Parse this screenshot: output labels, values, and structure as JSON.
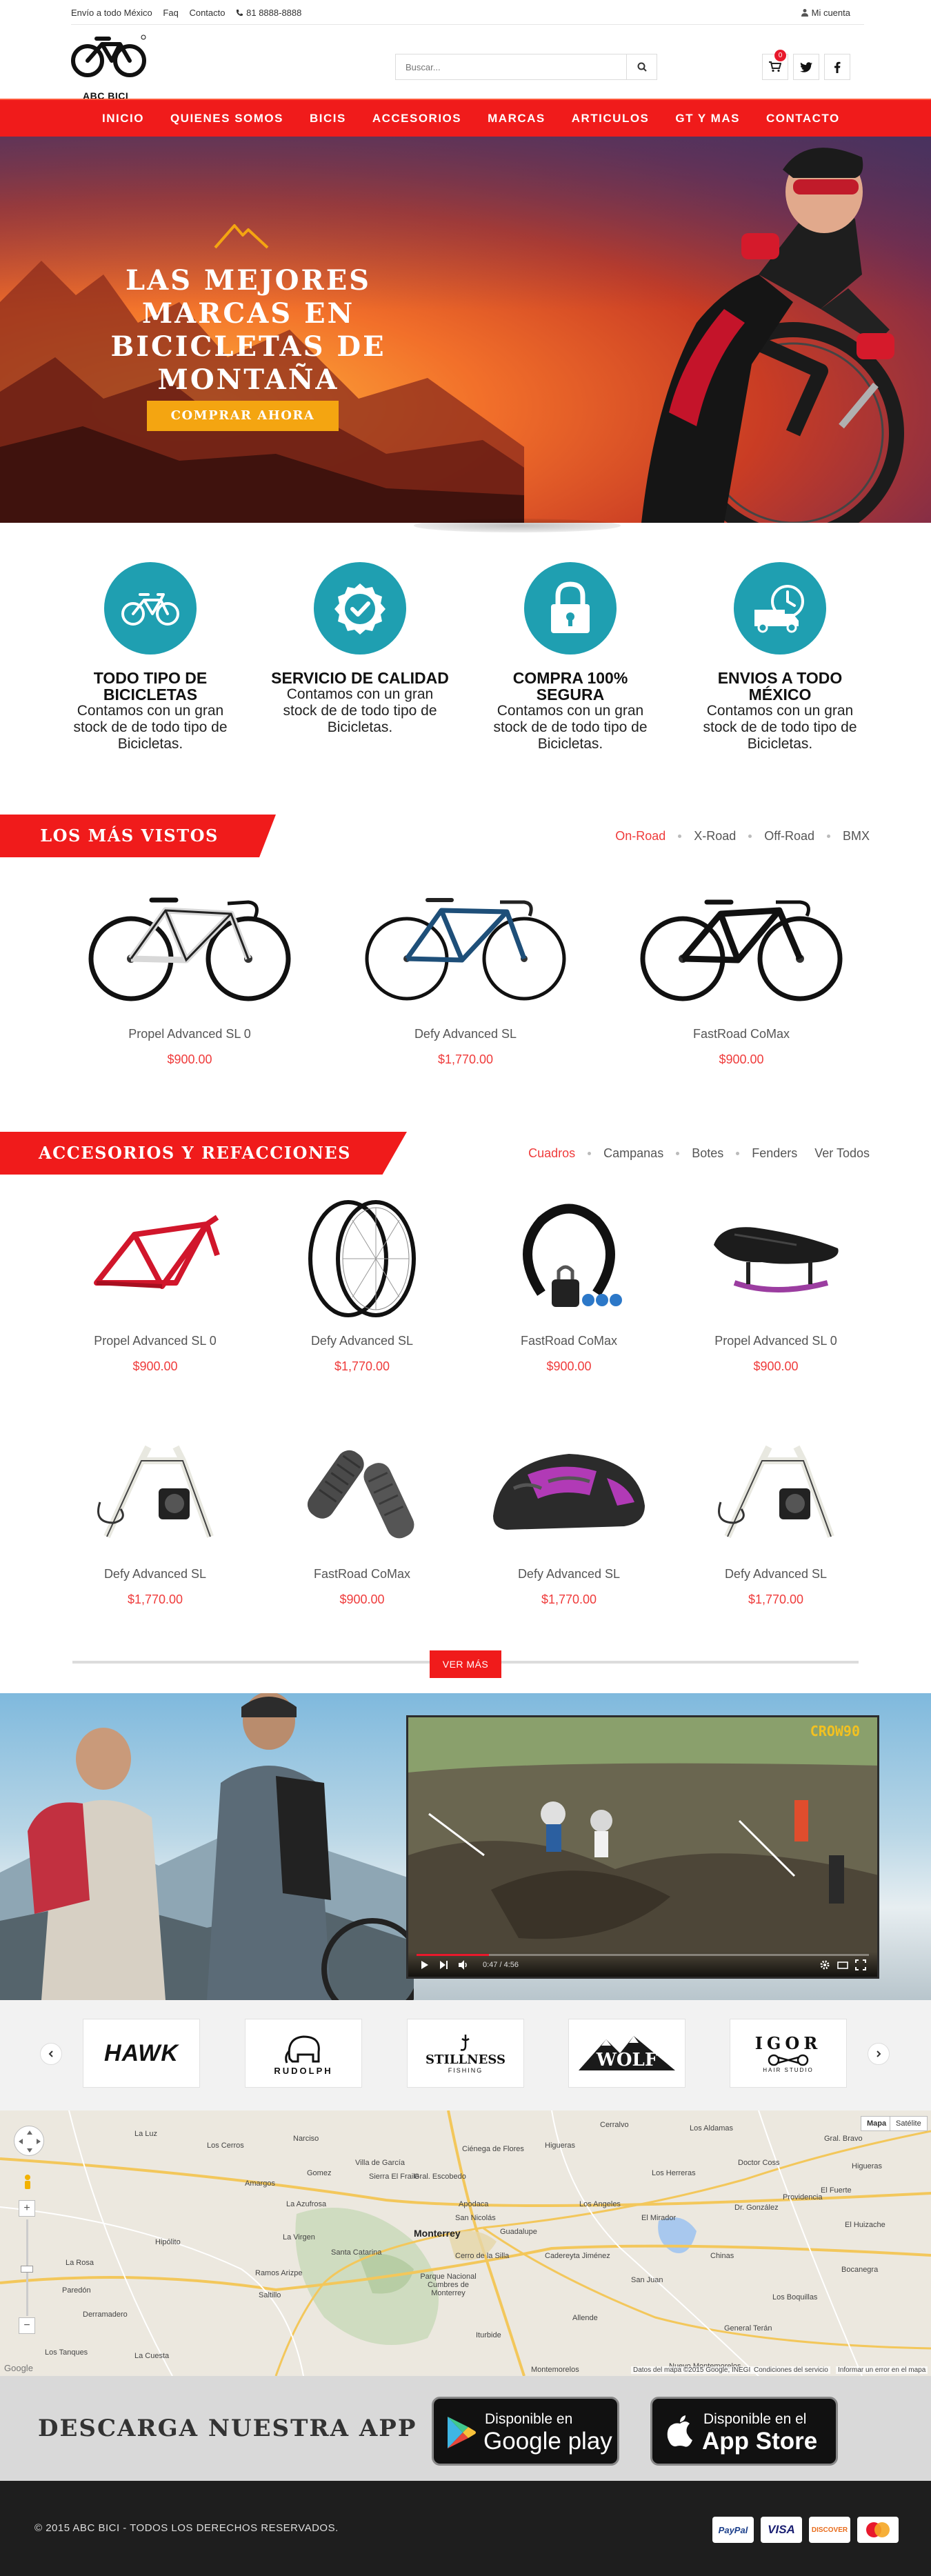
{
  "topbar": {
    "shipping": "Envío a todo México",
    "faq": "Faq",
    "contact": "Contacto",
    "phone": "81 8888-8888",
    "account": "Mi cuenta"
  },
  "header": {
    "logo_text": "ABC BICI",
    "search_placeholder": "Buscar...",
    "cart_count": "0"
  },
  "nav": [
    "INICIO",
    "QUIENES SOMOS",
    "BICIS",
    "ACCESORIOS",
    "MARCAS",
    "ARTICULOS",
    "GT Y MAS",
    "CONTACTO"
  ],
  "hero": {
    "title": "LAS MEJORES MARCAS EN BICICLETAS DE MONTAÑA",
    "cta": "COMPRAR AHORA"
  },
  "features": [
    {
      "title": "TODO TIPO DE BICICLETAS",
      "text": "Contamos con un gran stock de de todo tipo de Bicicletas.",
      "icon": "bicycle-icon"
    },
    {
      "title": "SERVICIO DE CALIDAD",
      "text": "Contamos con un gran stock de de todo tipo de Bicicletas.",
      "icon": "quality-badge-icon"
    },
    {
      "title": "COMPRA 100% SEGURA",
      "text": "Contamos con un gran stock de de todo tipo de Bicicletas.",
      "icon": "lock-icon"
    },
    {
      "title": "ENVIOS A TODO MÉXICO",
      "text": "Contamos con un gran stock de de todo tipo de Bicicletas.",
      "icon": "delivery-truck-icon"
    }
  ],
  "most_viewed": {
    "title": "LOS MÁS VISTOS",
    "tabs": [
      "On-Road",
      "X-Road",
      "Off-Road",
      "BMX"
    ],
    "active_tab": "On-Road",
    "products": [
      {
        "name": "Propel Advanced SL 0",
        "price": "$900.00"
      },
      {
        "name": "Defy Advanced SL",
        "price": "$1,770.00"
      },
      {
        "name": "FastRoad CoMax",
        "price": "$900.00"
      }
    ]
  },
  "accessories": {
    "title": "ACCESORIOS Y REFACCIONES",
    "tabs": [
      "Cuadros",
      "Campanas",
      "Botes",
      "Fenders",
      "Ver Todos"
    ],
    "active_tab": "Cuadros",
    "products": [
      {
        "name": "Propel Advanced SL 0",
        "price": "$900.00"
      },
      {
        "name": "Defy Advanced SL",
        "price": "$1,770.00"
      },
      {
        "name": "FastRoad CoMax",
        "price": "$900.00"
      },
      {
        "name": "Propel Advanced SL 0",
        "price": "$900.00"
      },
      {
        "name": "Defy Advanced SL",
        "price": "$1,770.00"
      },
      {
        "name": "FastRoad CoMax",
        "price": "$900.00"
      },
      {
        "name": "Defy Advanced SL",
        "price": "$1,770.00"
      },
      {
        "name": "Defy Advanced SL",
        "price": "$1,770.00"
      }
    ],
    "more": "VER MÁS"
  },
  "video": {
    "watermark": "CROW90",
    "time": "0:47 / 4:56",
    "progress": 0.16
  },
  "brands": [
    "HAWK",
    "RUDOLPH",
    "STILLNESS",
    "WOLF",
    "IGOR"
  ],
  "brand_subs": [
    "",
    "",
    "FISHING",
    "",
    "HAIR STUDIO"
  ],
  "map": {
    "city": "Monterrey",
    "map_button": "Mapa",
    "satellite_button": "Satélite",
    "attribution": "Datos del mapa ©2015 Google, INEGI",
    "terms": "Condiciones del servicio",
    "report": "Informar un error en el mapa",
    "places": [
      "La Luz",
      "Los Cerros",
      "Narciso",
      "Villa de García",
      "Ciénega de Flores",
      "Higueras",
      "Cerralvo",
      "Los Aldamas",
      "Los Herreras",
      "Doctor Coss",
      "El Fuerte",
      "Amargos",
      "Gomez",
      "La Azufrosa",
      "Gral. Escobedo",
      "Apodaca",
      "Los Angeles",
      "Providencia",
      "El Huizache",
      "Hipólito",
      "Santa Catarina",
      "San Nicolás",
      "Guadalupe",
      "Cadereyta Jiménez",
      "El Mirador",
      "San Juan",
      "Bocanegra",
      "La Virgen",
      "Ramos Arizpe",
      "Saltillo",
      "Allende",
      "General Terán",
      "Chinas",
      "Los Boquillas",
      "La Rosa",
      "Nuevo Montemorelos",
      "Montemorelos",
      "Paredón",
      "Los Tanques",
      "La Cuesta",
      "Derramadero",
      "Gral. Bravo",
      "Higueras",
      "Dr. González",
      "Sierra El Fraile",
      "Cerro de la Silla",
      "Parque Nacional Cumbres de Monterrey",
      "Iturbide"
    ]
  },
  "app": {
    "title": "DESCARGA NUESTRA APP",
    "google_small": "Disponible en",
    "google_big": "Google play",
    "apple_small": "Disponible en el",
    "apple_big": "App Store"
  },
  "footer": {
    "copyright": "© 2015 ABC BICI - TODOS LOS DERECHOS RESERVADOS.",
    "cards": [
      "PayPal",
      "VISA",
      "DISCOVER",
      "MasterCard"
    ]
  },
  "colors": {
    "brand_red": "#f01b1b",
    "teal": "#1f9fb1",
    "price_red": "#ef3b3b",
    "cta_orange": "#f4a511"
  }
}
